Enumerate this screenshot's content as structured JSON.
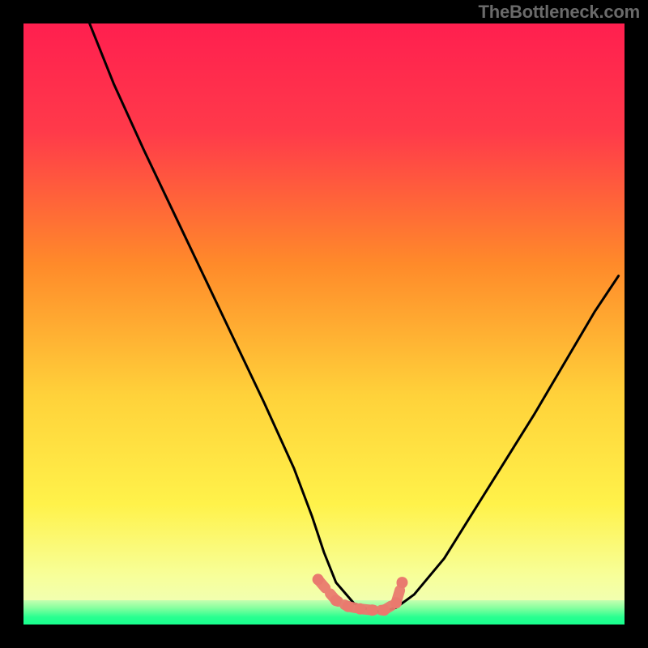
{
  "watermark": "TheBottleneck.com",
  "chart_data": {
    "type": "line",
    "title": "",
    "xlabel": "",
    "ylabel": "",
    "xlim": [
      0,
      100
    ],
    "ylim": [
      0,
      100
    ],
    "series": [
      {
        "name": "curve",
        "x": [
          11,
          15,
          20,
          25,
          30,
          35,
          40,
          45,
          48,
          50,
          52,
          55,
          58,
          60,
          62,
          65,
          70,
          75,
          80,
          85,
          90,
          95,
          99
        ],
        "values": [
          100,
          90,
          79,
          68.5,
          58,
          47.5,
          37,
          26,
          18,
          12,
          7,
          3.5,
          2.2,
          2.2,
          2.8,
          5,
          11,
          19,
          27,
          35,
          43.5,
          52,
          58
        ]
      }
    ],
    "annotations": {
      "watermark": "TheBottleneck.com",
      "colors": {
        "gradient_top": "#ff1f4f",
        "gradient_upper_mid": "#ff8a2a",
        "gradient_mid": "#ffe24a",
        "gradient_lower": "#f7ff9a",
        "bottom_band": "#18ff8d",
        "curve": "#000000",
        "markers": "#e97a6e",
        "frame": "#000000"
      },
      "markers": {
        "x": [
          49,
          52,
          54,
          56,
          58,
          60,
          62,
          63
        ],
        "values": [
          7.5,
          4.0,
          3.0,
          2.6,
          2.4,
          2.4,
          3.6,
          7.0
        ]
      }
    }
  }
}
